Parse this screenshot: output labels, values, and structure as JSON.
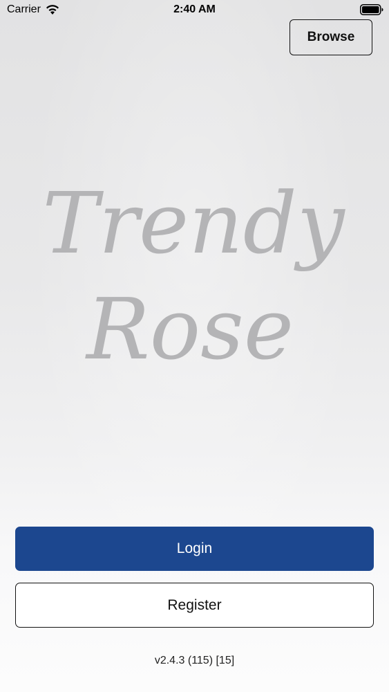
{
  "status_bar": {
    "carrier": "Carrier",
    "time": "2:40 AM",
    "wifi_icon": "wifi-icon",
    "battery_icon": "battery-icon"
  },
  "header": {
    "browse_label": "Browse"
  },
  "logo": {
    "line1": "Trendy",
    "line2": "Rose",
    "color": "#b4b4b6"
  },
  "actions": {
    "login_label": "Login",
    "register_label": "Register",
    "login_color": "#1c478f"
  },
  "footer": {
    "version": "v2.4.3 (115) [15]"
  }
}
